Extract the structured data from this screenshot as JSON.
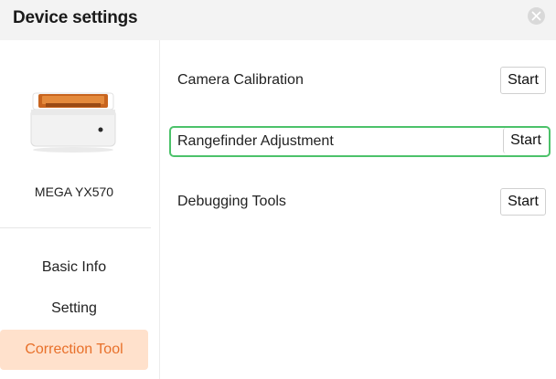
{
  "header": {
    "title": "Device settings",
    "close_icon": "close-icon"
  },
  "device": {
    "name": "MEGA YX570",
    "image_icon": "laser-engraver-device"
  },
  "sidebar": {
    "items": [
      {
        "label": "Basic Info",
        "active": false
      },
      {
        "label": "Setting",
        "active": false
      },
      {
        "label": "Correction Tool",
        "active": true
      }
    ]
  },
  "tools": [
    {
      "label": "Camera Calibration",
      "button": "Start",
      "highlighted": false
    },
    {
      "label": "Rangefinder Adjustment",
      "button": "Start",
      "highlighted": true
    },
    {
      "label": "Debugging Tools",
      "button": "Start",
      "highlighted": false
    }
  ],
  "colors": {
    "accent": "#e8702a",
    "active_bg": "#ffe1cc",
    "highlight": "#4cc26a"
  }
}
